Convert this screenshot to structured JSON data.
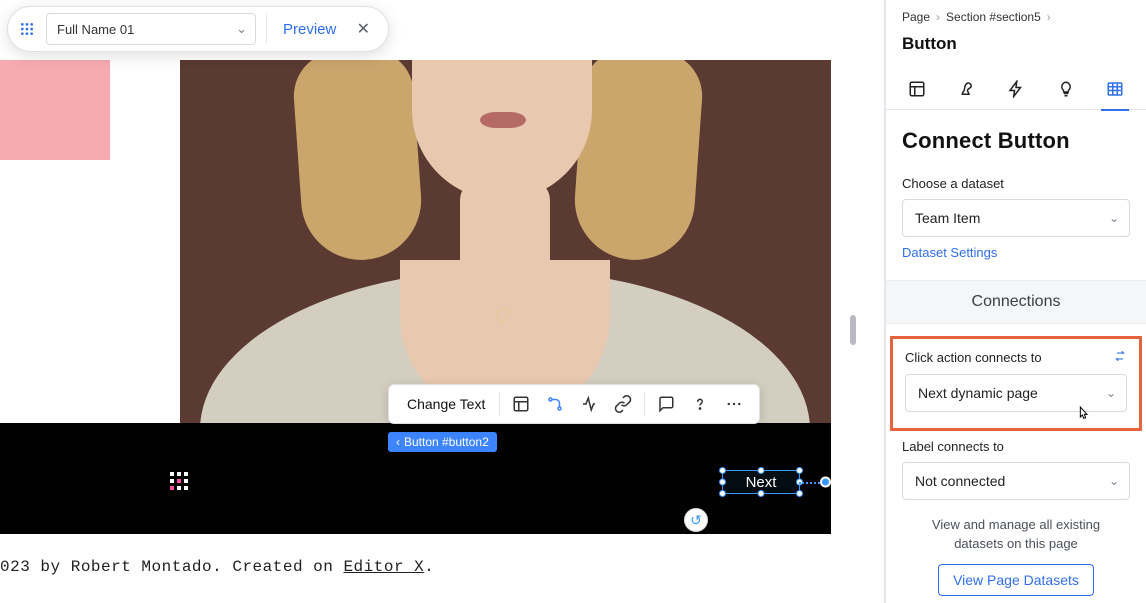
{
  "top_pill": {
    "select_value": "Full Name 01",
    "preview_label": "Preview"
  },
  "context_toolbar": {
    "change_text": "Change Text"
  },
  "selected_element": {
    "tag_label": "Button #button2",
    "button_text": "Next"
  },
  "footer": {
    "text_prefix": "023 by Robert Montado. Created on ",
    "text_link": "Editor X",
    "text_suffix": "."
  },
  "panel": {
    "breadcrumb": {
      "a": "Page",
      "b": "Section #section5"
    },
    "title": "Button",
    "connect_heading": "Connect Button",
    "dataset_label": "Choose a dataset",
    "dataset_value": "Team Item",
    "dataset_settings": "Dataset Settings",
    "connections_heading": "Connections",
    "click_label": "Click action connects to",
    "click_value": "Next dynamic page",
    "label_connects": "Label connects to",
    "label_value": "Not connected",
    "note": "View and manage all existing datasets on this page",
    "view_datasets_btn": "View Page Datasets"
  }
}
